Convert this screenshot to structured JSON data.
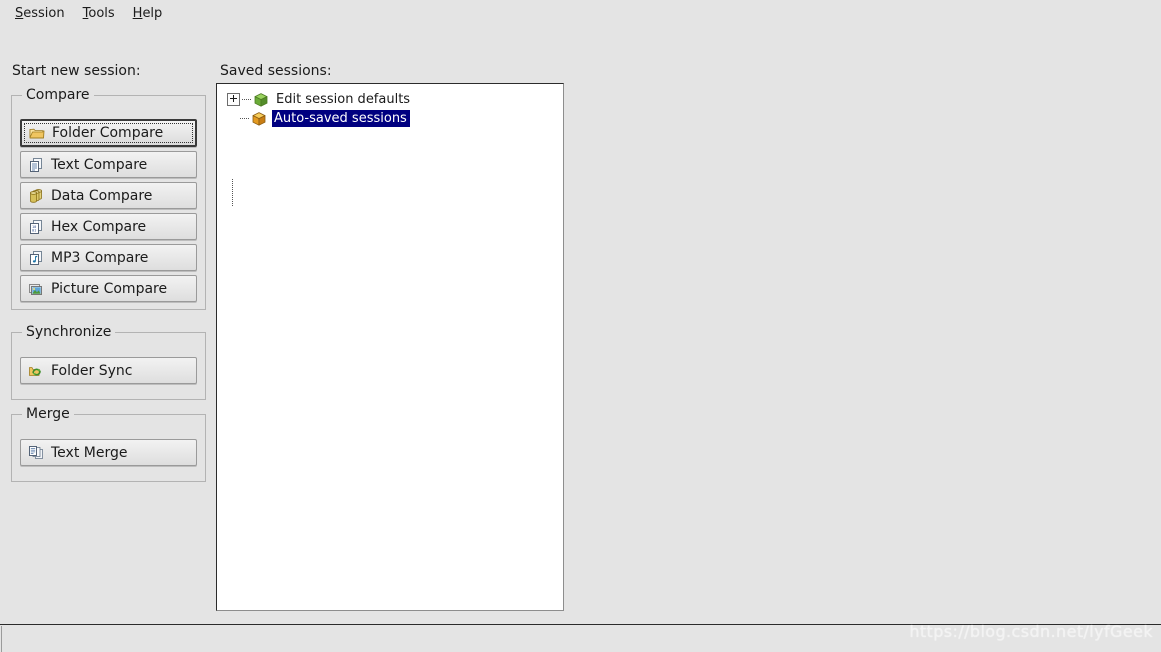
{
  "menubar": {
    "items": [
      {
        "label": "Session",
        "mnemonic": "S",
        "rest": "ession"
      },
      {
        "label": "Tools",
        "mnemonic": "T",
        "rest": "ools"
      },
      {
        "label": "Help",
        "mnemonic": "H",
        "rest": "elp"
      }
    ]
  },
  "labels": {
    "start_new_session": "Start new session:",
    "saved_sessions": "Saved sessions:"
  },
  "groups": [
    {
      "legend": "Compare"
    },
    {
      "legend": "Synchronize"
    },
    {
      "legend": "Merge"
    }
  ],
  "buttons": {
    "folder_compare": {
      "label": "Folder Compare",
      "icon": "folder-icon",
      "default": true,
      "focused": true
    },
    "text_compare": {
      "label": "Text Compare",
      "icon": "text-document-icon",
      "default": false,
      "focused": false
    },
    "data_compare": {
      "label": "Data Compare",
      "icon": "database-icon",
      "default": false,
      "focused": false
    },
    "hex_compare": {
      "label": "Hex Compare",
      "icon": "hex-document-icon",
      "default": false,
      "focused": false
    },
    "mp3_compare": {
      "label": "MP3 Compare",
      "icon": "music-document-icon",
      "default": false,
      "focused": false
    },
    "picture_compare": {
      "label": "Picture Compare",
      "icon": "picture-icon",
      "default": false,
      "focused": false
    },
    "folder_sync": {
      "label": "Folder Sync",
      "icon": "sync-arrows-icon",
      "default": false,
      "focused": false
    },
    "text_merge": {
      "label": "Text Merge",
      "icon": "merge-document-icon",
      "default": false,
      "focused": false
    }
  },
  "tree": {
    "items": [
      {
        "label": "Edit session defaults",
        "icon": "green-cube-icon",
        "icon_color": "#7cc24a",
        "expandable": true,
        "expanded": false,
        "selected": false
      },
      {
        "label": "Auto-saved sessions",
        "icon": "orange-cube-icon",
        "icon_color": "#f0a81e",
        "expandable": false,
        "expanded": false,
        "selected": true
      }
    ],
    "selection_color": "#000080",
    "selection_text_color": "#ffffff"
  },
  "statusbar": {
    "text": ""
  },
  "watermark": {
    "text": "https://blog.csdn.net/lyfGeek"
  },
  "colors": {
    "window_background": "#e4e4e4",
    "panel_background": "#ffffff",
    "text": "#1b1b1b",
    "selection": "#000080"
  }
}
